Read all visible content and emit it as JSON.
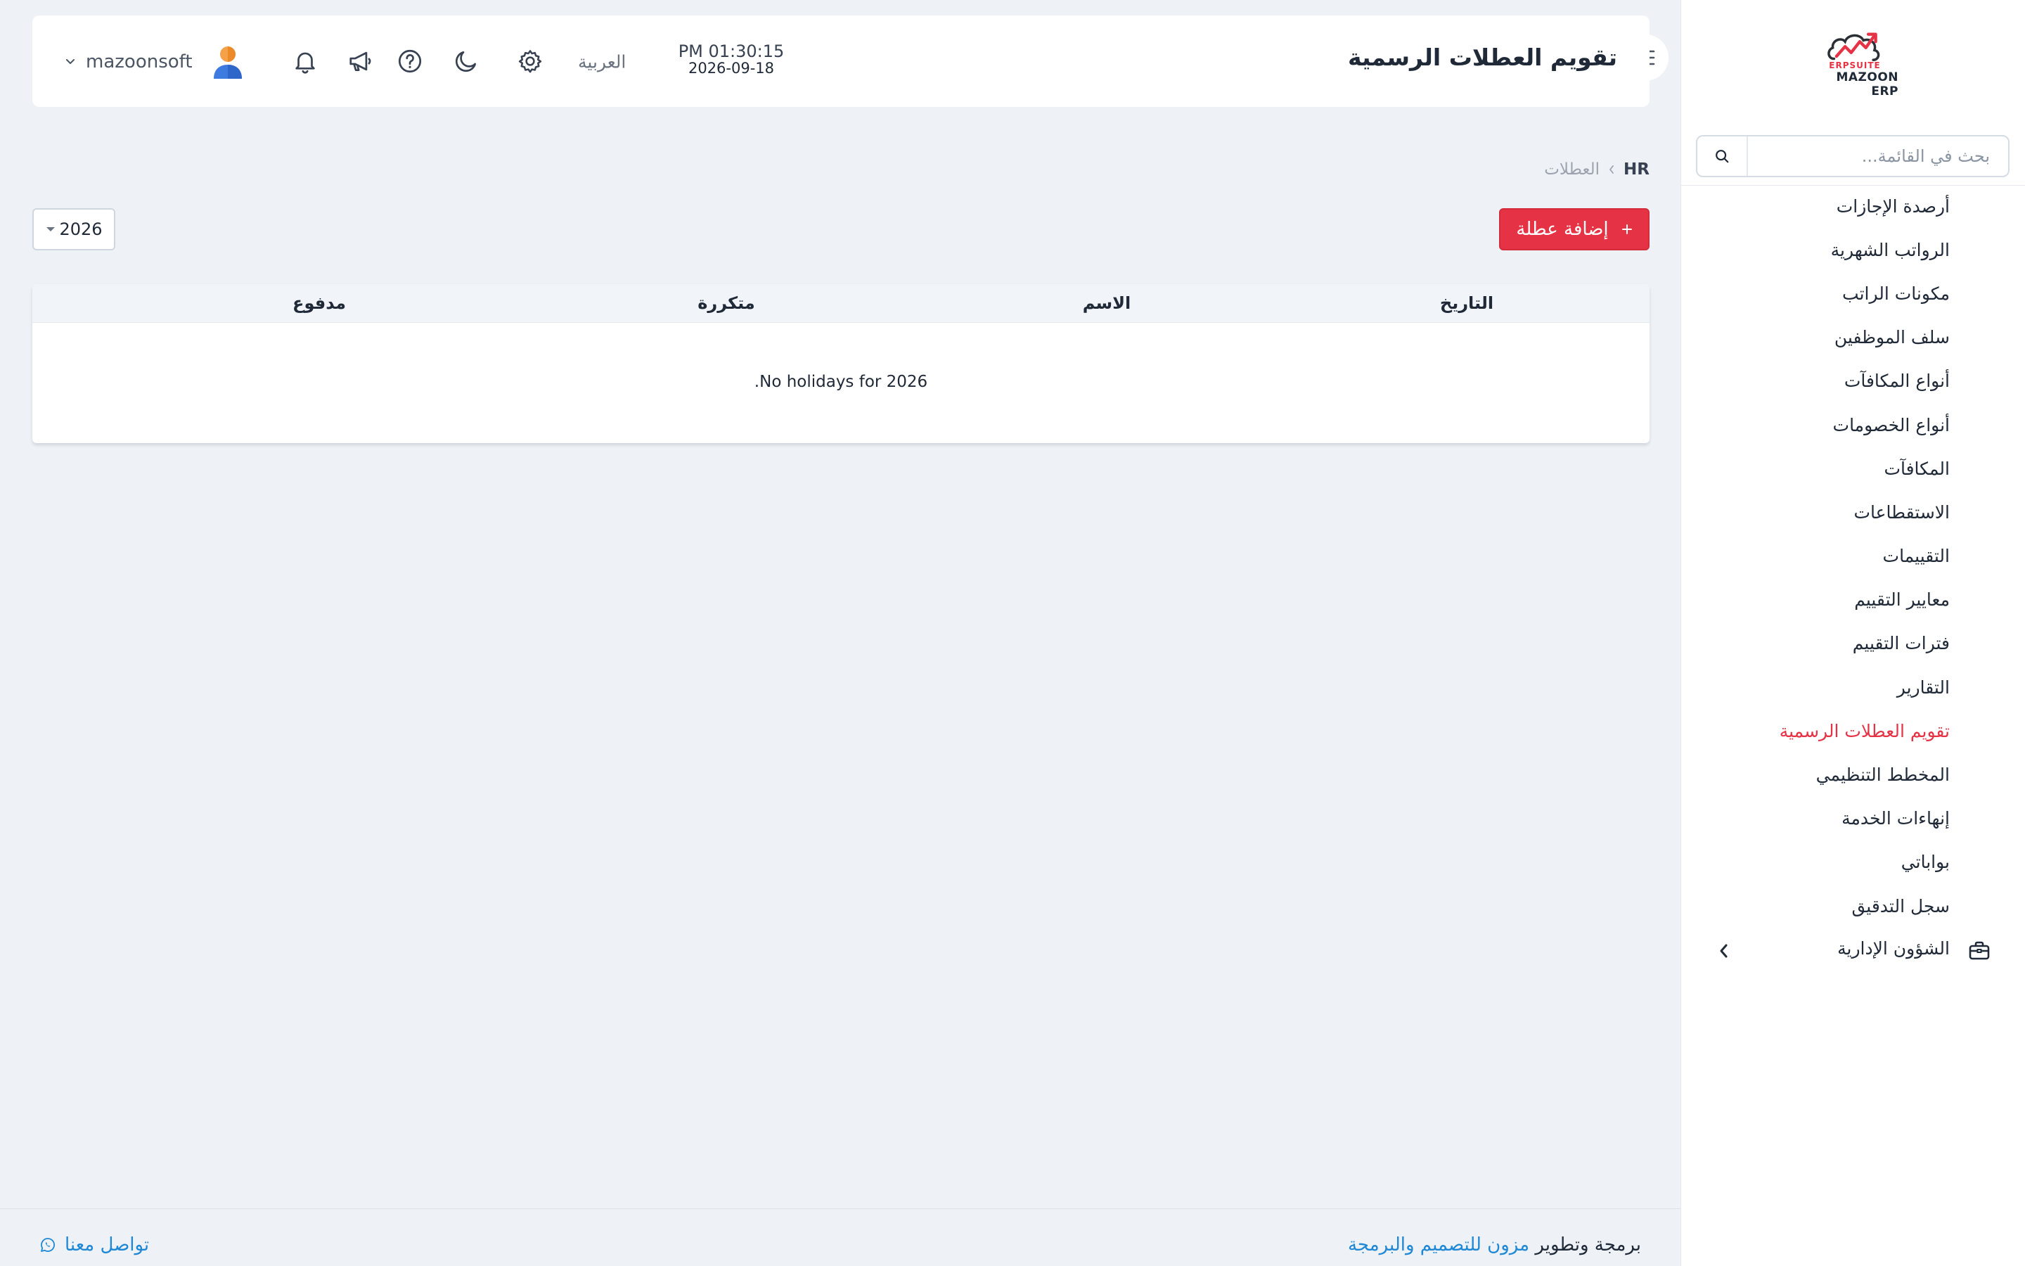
{
  "app": {
    "brand_name": "MAZOON ERP",
    "brand_sub": "ERPSUITE"
  },
  "sidebar": {
    "search_placeholder": "بحث في القائمة...",
    "items": [
      {
        "label": "أرصدة الإجازات",
        "active": false
      },
      {
        "label": "الرواتب الشهرية",
        "active": false
      },
      {
        "label": "مكونات الراتب",
        "active": false
      },
      {
        "label": "سلف الموظفين",
        "active": false
      },
      {
        "label": "أنواع المكافآت",
        "active": false
      },
      {
        "label": "أنواع الخصومات",
        "active": false
      },
      {
        "label": "المكافآت",
        "active": false
      },
      {
        "label": "الاستقطاعات",
        "active": false
      },
      {
        "label": "التقييمات",
        "active": false
      },
      {
        "label": "معايير التقييم",
        "active": false
      },
      {
        "label": "فترات التقييم",
        "active": false
      },
      {
        "label": "التقارير",
        "active": false
      },
      {
        "label": "تقويم العطلات الرسمية",
        "active": true
      },
      {
        "label": "المخطط التنظيمي",
        "active": false
      },
      {
        "label": "إنهاءات الخدمة",
        "active": false
      },
      {
        "label": "بواباتي",
        "active": false
      },
      {
        "label": "سجل التدقيق",
        "active": false
      }
    ],
    "group": {
      "label": "الشؤون الإدارية",
      "icon": "briefcase-icon"
    }
  },
  "header": {
    "title": "تقويم العطلات الرسمية",
    "time": "PM 01:30:15",
    "date": "2026-09-18",
    "language_label": "العربية",
    "username": "mazoonsoft",
    "icons": [
      "gear-icon",
      "moon-icon",
      "help-icon",
      "megaphone-icon",
      "bell-icon"
    ]
  },
  "breadcrumb": {
    "root": "HR",
    "current": "العطلات"
  },
  "toolbar": {
    "add_label": "إضافة عطلة",
    "year_value": "2026"
  },
  "table": {
    "columns": [
      "التاريخ",
      "الاسم",
      "متكررة",
      "مدفوع"
    ],
    "empty_message": "No holidays for 2026."
  },
  "footer": {
    "credit_prefix": "برمجة وتطوير",
    "credit_link": "مزون للتصميم والبرمجة",
    "contact_label": "تواصل معنا"
  },
  "colors": {
    "accent": "#e53345",
    "link": "#1f88d6",
    "page_bg": "#eef2f6"
  }
}
